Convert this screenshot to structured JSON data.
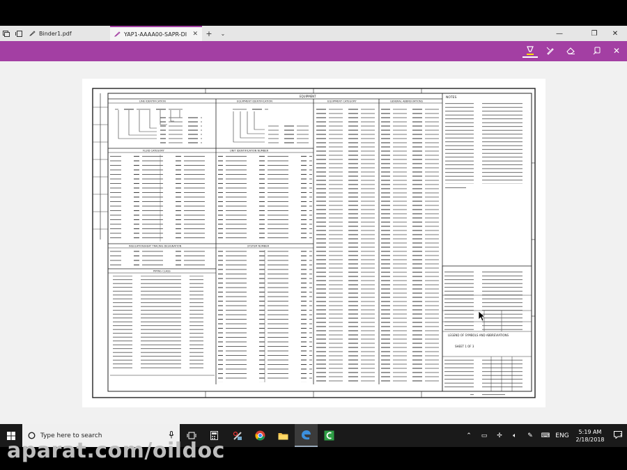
{
  "browser": {
    "tabs": [
      {
        "label": "Binder1.pdf",
        "active": false
      },
      {
        "label": "YAP1-AAAA00-SAPR-DI",
        "active": true
      }
    ],
    "accent": "#a33fa3"
  },
  "document": {
    "title_block": {
      "section_equipment": "EQUIPMENT",
      "line_identification": "LINE IDENTIFICATION",
      "equipment_identification": "EQUIPMENT IDENTIFICATION",
      "equipment_category": "EQUIPMENT CATEGORY",
      "general_abbreviations": "GENERAL ABBREVIATIONS",
      "fluid_category": "FLUID CATEGORY",
      "unit_identification_number": "UNIT IDENTIFICATION NUMBER",
      "insulation_heat_tracing": "INSULATION/HEAT TRACING DESIGNATION",
      "system_number": "SYSTEM NUMBER",
      "piping_class": "PIPING CLASS",
      "notes": "NOTES",
      "legend_title": "LEGEND OF SYMBOLS AND ABBREVIATIONS",
      "sheet": "SHEET 1 OF 3"
    }
  },
  "taskbar": {
    "search_placeholder": "Type here to search",
    "language": "ENG",
    "time": "5:19 AM",
    "date": "2/18/2018"
  },
  "watermark": "aparat.com/oildoc"
}
